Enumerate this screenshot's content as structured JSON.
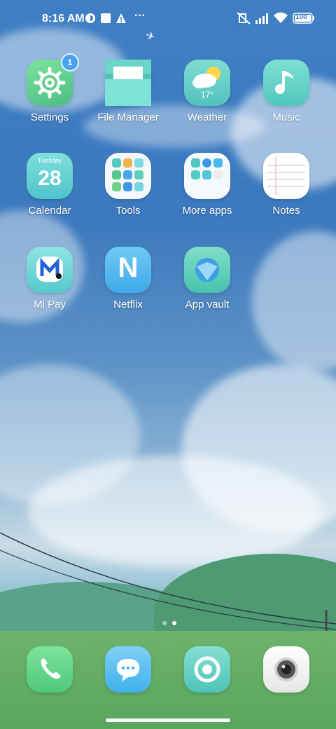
{
  "status_bar": {
    "time": "8:16 AM",
    "more_indicator": "···",
    "battery": "100",
    "icons": [
      "vpn-icon",
      "square-notification-icon",
      "warning-icon",
      "silent-icon",
      "signal-icon",
      "wifi-icon",
      "battery-icon"
    ]
  },
  "apps": [
    {
      "label": "Settings",
      "badge": "1",
      "icon": "gear-icon",
      "color": "#5ec58e"
    },
    {
      "label": "File Manager",
      "icon": "folder-icon",
      "color": "#4dc3b5"
    },
    {
      "label": "Weather",
      "icon": "weather-icon",
      "temp": "17°",
      "color": "#68cfc6"
    },
    {
      "label": "Music",
      "icon": "music-note-icon",
      "color": "#62d1c4"
    },
    {
      "label": "Calendar",
      "icon": "calendar-icon",
      "day_name": "Tuesday",
      "day_num": "28",
      "color": "#66d0d4"
    },
    {
      "label": "Tools",
      "icon": "tools-folder-icon",
      "color": "#ffffff"
    },
    {
      "label": "More apps",
      "icon": "apps-folder-icon",
      "color": "#ffffff"
    },
    {
      "label": "Notes",
      "icon": "notes-icon",
      "color": "#ffffff"
    },
    {
      "label": "Mi Pay",
      "icon": "mi-pay-icon",
      "color": "#5ccfd0"
    },
    {
      "label": "Netflix",
      "icon": "netflix-icon",
      "letter": "N",
      "color": "#4fb7f0"
    },
    {
      "label": "App vault",
      "icon": "app-vault-icon",
      "color": "#57cdb6"
    }
  ],
  "dock": [
    {
      "name": "phone",
      "icon": "phone-icon",
      "color": "#5fd37e"
    },
    {
      "name": "messaging",
      "icon": "chat-bubble-icon",
      "color": "#4ab8f0"
    },
    {
      "name": "browser",
      "icon": "browser-icon",
      "color": "#59cbbf"
    },
    {
      "name": "camera",
      "icon": "camera-icon",
      "color": "#f4f4f4"
    }
  ],
  "page_indicator": {
    "pages": 2,
    "active": 2
  }
}
